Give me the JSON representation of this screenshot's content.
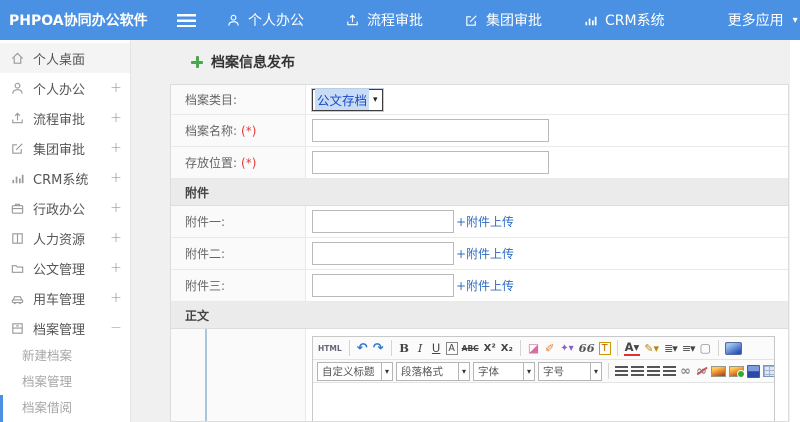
{
  "colors": {
    "topbar_blue": "#4a91e3",
    "link_blue": "#2f6cc0",
    "required_red": "#e23b3b",
    "plus_green": "#4ca74c"
  },
  "topbar": {
    "brand": "PHPOA协同办公软件",
    "items": [
      {
        "label": "个人办公",
        "icon": "user-icon",
        "ic": "user",
        "caret": ""
      },
      {
        "label": "流程审批",
        "icon": "flow-icon",
        "ic": "flow",
        "caret": ""
      },
      {
        "label": "集团审批",
        "icon": "edit-icon",
        "ic": "edit",
        "caret": ""
      },
      {
        "label": "CRM系统",
        "icon": "chart-icon",
        "ic": "chart",
        "caret": ""
      },
      {
        "label": "更多应用",
        "icon": "more-apps",
        "ic": "",
        "caret": "▾"
      }
    ]
  },
  "sidebar": {
    "items": [
      {
        "label": "个人桌面",
        "icon": "home-icon",
        "ic": "home",
        "toggle": "",
        "cls": "active"
      },
      {
        "label": "个人办公",
        "icon": "user-icon",
        "ic": "user",
        "toggle": "+",
        "cls": ""
      },
      {
        "label": "流程审批",
        "icon": "flow-icon",
        "ic": "flow",
        "toggle": "+",
        "cls": ""
      },
      {
        "label": "集团审批",
        "icon": "edit-icon",
        "ic": "edit",
        "toggle": "+",
        "cls": ""
      },
      {
        "label": "CRM系统",
        "icon": "chart-icon",
        "ic": "chart",
        "toggle": "+",
        "cls": ""
      },
      {
        "label": "行政办公",
        "icon": "briefcase-icon",
        "ic": "briefcase",
        "toggle": "+",
        "cls": ""
      },
      {
        "label": "人力资源",
        "icon": "book-icon",
        "ic": "book",
        "toggle": "+",
        "cls": ""
      },
      {
        "label": "公文管理",
        "icon": "folder-icon",
        "ic": "folder",
        "toggle": "+",
        "cls": ""
      },
      {
        "label": "用车管理",
        "icon": "car-icon",
        "ic": "car",
        "toggle": "+",
        "cls": ""
      },
      {
        "label": "档案管理",
        "icon": "archive-icon",
        "ic": "archive",
        "toggle": "−",
        "cls": ""
      }
    ],
    "subitems": [
      "新建档案",
      "档案管理",
      "档案借阅"
    ]
  },
  "main": {
    "page_title": "档案信息发布",
    "form": {
      "required_mark": "(*)",
      "category": {
        "label": "档案类目:",
        "value": "公文存档",
        "caret": "▾"
      },
      "name": {
        "label": "档案名称:"
      },
      "location": {
        "label": "存放位置:"
      },
      "attach_header": "附件",
      "attachments": [
        {
          "label": "附件一:",
          "link": "+附件上传"
        },
        {
          "label": "附件二:",
          "link": "+附件上传"
        },
        {
          "label": "附件三:",
          "link": "+附件上传"
        }
      ],
      "body_header": "正文"
    },
    "editor": {
      "selects": [
        {
          "label": "自定义标题",
          "caret": "▾",
          "w": "sel-w1"
        },
        {
          "label": "段落格式",
          "caret": "▾",
          "w": "sel-w2"
        },
        {
          "label": "字体",
          "caret": "▾",
          "w": "sel-w3"
        },
        {
          "label": "字号",
          "caret": "▾",
          "w": "sel-w4"
        }
      ],
      "toolbar1": [
        {
          "n": "html-source-icon",
          "t": "HTML",
          "c": "tb-html"
        },
        {
          "n": "toolbar-separator",
          "t": "",
          "c": "tbsep",
          "ia": "false"
        },
        {
          "n": "undo-icon",
          "t": "↶",
          "c": "blue"
        },
        {
          "n": "redo-icon",
          "t": "↷",
          "c": "blue"
        },
        {
          "n": "toolbar-separator",
          "t": "",
          "c": "tbsep",
          "ia": "false"
        },
        {
          "n": "bold-icon",
          "t": "B",
          "c": "boldic"
        },
        {
          "n": "italic-icon",
          "t": "I",
          "c": "italic"
        },
        {
          "n": "underline-icon",
          "t": "U",
          "c": "underl"
        },
        {
          "n": "font-box-icon",
          "t": "A",
          "c": "boxed"
        },
        {
          "n": "strikethrough-icon",
          "t": "ABC",
          "c": "strike"
        },
        {
          "n": "superscript-icon",
          "t": "X²",
          "c": "supsub"
        },
        {
          "n": "subscript-icon",
          "t": "X₂",
          "c": "supsub"
        },
        {
          "n": "toolbar-separator",
          "t": "",
          "c": "tbsep",
          "ia": "false"
        },
        {
          "n": "eraser-icon",
          "t": "◪",
          "c": "pink"
        },
        {
          "n": "clean-format-icon",
          "t": "✐",
          "c": "orangeic"
        },
        {
          "n": "format-painter-icon",
          "t": "✦▾",
          "c": "purple"
        },
        {
          "n": "blockquote-icon",
          "t": "66",
          "c": "quote"
        },
        {
          "n": "paste-word-icon",
          "t": "T",
          "c": "boxed orange-b"
        },
        {
          "n": "toolbar-separator",
          "t": "",
          "c": "tbsep",
          "ia": "false"
        },
        {
          "n": "font-color-icon",
          "t": "A▾",
          "c": "fontcolor"
        },
        {
          "n": "highlight-color-icon",
          "t": "✎▾",
          "c": "hlpen"
        },
        {
          "n": "ordered-list-icon",
          "t": "≣▾",
          "c": "listic"
        },
        {
          "n": "unordered-list-icon",
          "t": "≡▾",
          "c": "listic"
        },
        {
          "n": "new-page-icon",
          "t": "▢",
          "c": "docic"
        },
        {
          "n": "toolbar-separator",
          "t": "",
          "c": "tbsep",
          "ia": "false"
        },
        {
          "n": "fullscreen-icon",
          "t": "",
          "c": "monitor"
        }
      ],
      "toolbar2": [
        {
          "n": "toolbar-separator",
          "t": "",
          "c": "tbsep",
          "ia": "false"
        },
        {
          "n": "align-left-icon",
          "t": "",
          "c": "al"
        },
        {
          "n": "align-center-icon",
          "t": "",
          "c": "al"
        },
        {
          "n": "align-right-icon",
          "t": "",
          "c": "al"
        },
        {
          "n": "align-justify-icon",
          "t": "",
          "c": "al"
        },
        {
          "n": "link-icon",
          "t": "∞",
          "c": "chain"
        },
        {
          "n": "unlink-icon",
          "t": "∞",
          "c": "chain unlink"
        },
        {
          "n": "image-icon",
          "t": "",
          "c": "img1"
        },
        {
          "n": "insert-image-icon",
          "t": "",
          "c": "img1 img2"
        },
        {
          "n": "media-icon",
          "t": "",
          "c": "media"
        },
        {
          "n": "table-icon",
          "t": "",
          "c": "tablegrid"
        }
      ]
    }
  }
}
